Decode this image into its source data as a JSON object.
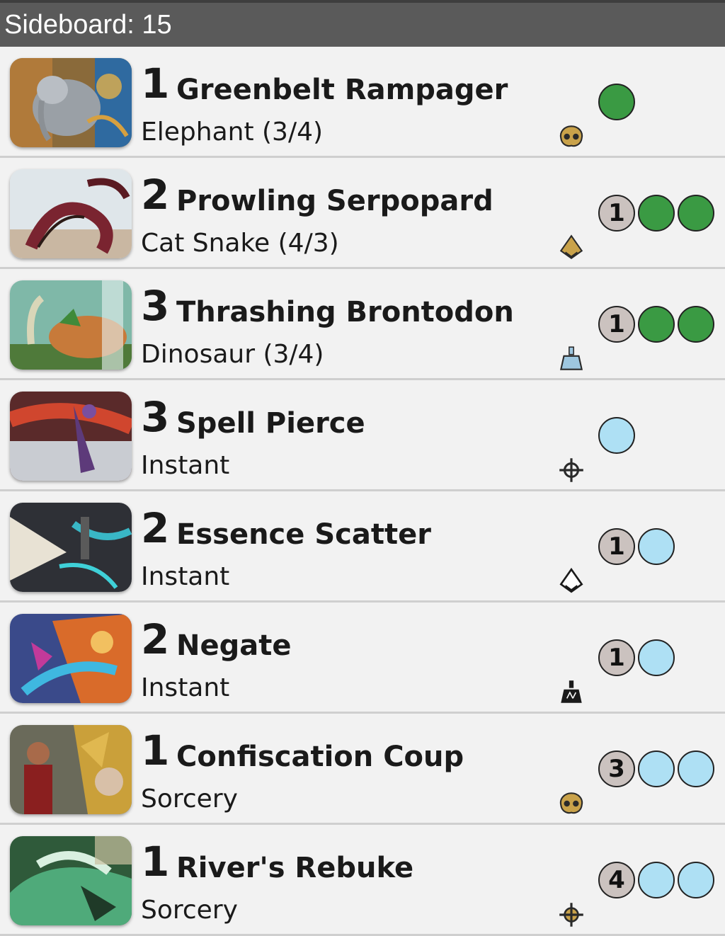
{
  "header": {
    "title": "Sideboard: 15"
  },
  "colors": {
    "green": "#3a9a43",
    "blue": "#aee0f4",
    "generic": "#cbc2bf"
  },
  "cards": [
    {
      "qty": "1",
      "name": "Greenbelt Rampager",
      "type": "Elephant (3/4)",
      "set_icon": "kaladesh-set-icon",
      "cost": [
        {
          "kind": "green"
        }
      ],
      "art": "elephant-art"
    },
    {
      "qty": "2",
      "name": "Prowling Serpopard",
      "type": "Cat Snake (4/3)",
      "set_icon": "amonkhet-set-icon",
      "cost": [
        {
          "kind": "generic",
          "value": "1"
        },
        {
          "kind": "green"
        },
        {
          "kind": "green"
        }
      ],
      "art": "serpopard-art"
    },
    {
      "qty": "3",
      "name": "Thrashing Brontodon",
      "type": "Dinosaur (3/4)",
      "set_icon": "ixalan-set-icon",
      "cost": [
        {
          "kind": "generic",
          "value": "1"
        },
        {
          "kind": "green"
        },
        {
          "kind": "green"
        }
      ],
      "art": "brontodon-art"
    },
    {
      "qty": "3",
      "name": "Spell Pierce",
      "type": "Instant",
      "set_icon": "ixalan-compass-set-icon",
      "cost": [
        {
          "kind": "blue"
        }
      ],
      "art": "spell-pierce-art"
    },
    {
      "qty": "2",
      "name": "Essence Scatter",
      "type": "Instant",
      "set_icon": "amonkhet-set-icon",
      "cost": [
        {
          "kind": "generic",
          "value": "1"
        },
        {
          "kind": "blue"
        }
      ],
      "art": "essence-scatter-art"
    },
    {
      "qty": "2",
      "name": "Negate",
      "type": "Instant",
      "set_icon": "ixalan-set-icon",
      "cost": [
        {
          "kind": "generic",
          "value": "1"
        },
        {
          "kind": "blue"
        }
      ],
      "art": "negate-art"
    },
    {
      "qty": "1",
      "name": "Confiscation Coup",
      "type": "Sorcery",
      "set_icon": "kaladesh-set-icon",
      "cost": [
        {
          "kind": "generic",
          "value": "3"
        },
        {
          "kind": "blue"
        },
        {
          "kind": "blue"
        }
      ],
      "art": "confiscation-coup-art"
    },
    {
      "qty": "1",
      "name": "River's Rebuke",
      "type": "Sorcery",
      "set_icon": "ixalan-compass-set-icon",
      "cost": [
        {
          "kind": "generic",
          "value": "4"
        },
        {
          "kind": "blue"
        },
        {
          "kind": "blue"
        }
      ],
      "art": "rivers-rebuke-art"
    }
  ]
}
